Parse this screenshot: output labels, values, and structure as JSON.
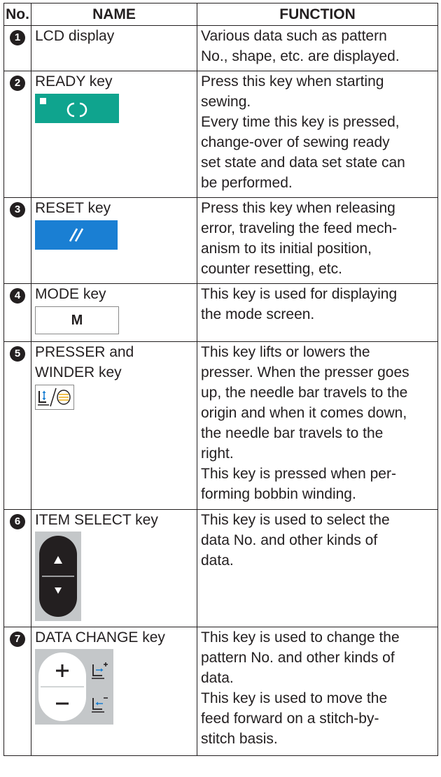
{
  "header": {
    "no": "No.",
    "name": "NAME",
    "function": "FUNCTION"
  },
  "rows": [
    {
      "num": "1",
      "name": "LCD display",
      "func": [
        "Various data such as pattern",
        "No., shape, etc. are displayed."
      ],
      "icon": ""
    },
    {
      "num": "2",
      "name": "READY key",
      "func": [
        "Press this key when starting",
        "sewing.",
        "Every time this key is pressed,",
        "change-over of sewing ready",
        "set state and data set state can",
        "be performed."
      ],
      "icon": "ready-key-icon"
    },
    {
      "num": "3",
      "name": "RESET key",
      "func": [
        "Press this key when releasing",
        "error, traveling the feed mech-",
        "anism to its initial position,",
        "counter resetting, etc."
      ],
      "icon": "reset-key-icon"
    },
    {
      "num": "4",
      "name": "MODE key",
      "func": [
        "This key is used for displaying",
        "the mode screen."
      ],
      "icon": "mode-key-icon",
      "icon_text": "M"
    },
    {
      "num": "5",
      "name": [
        "PRESSER and",
        "WINDER key"
      ],
      "func": [
        "This key lifts or lowers the",
        "presser. When the presser goes",
        "up, the needle bar travels to the",
        "origin and when it comes down,",
        "the needle bar travels to the",
        "right.",
        "This key is pressed when per-",
        "forming bobbin winding."
      ],
      "icon": "presser-winder-key-icon"
    },
    {
      "num": "6",
      "name": "ITEM SELECT key",
      "func": [
        "This key is used to select the",
        "data No. and other kinds of",
        "data."
      ],
      "icon": "item-select-key-icon"
    },
    {
      "num": "7",
      "name": "DATA CHANGE key",
      "func": [
        "This key is used to change the",
        "pattern No. and other kinds of",
        "data.",
        "This key is used to move the",
        "feed forward on a stitch-by-",
        "stitch basis."
      ],
      "icon": "data-change-key-icon"
    }
  ],
  "colors": {
    "ready": "#0fa48e",
    "reset": "#1a7fd3",
    "winder_yellow": "#f0b323",
    "arrow_blue": "#1a7fd3"
  }
}
